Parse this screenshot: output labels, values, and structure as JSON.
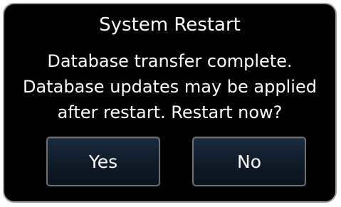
{
  "dialog": {
    "title": "System Restart",
    "message_lines": [
      "Database transfer complete.",
      "Database updates may be applied",
      "after restart. Restart now?"
    ],
    "buttons": {
      "yes_label": "Yes",
      "no_label": "No"
    }
  },
  "colors": {
    "background": "#000000",
    "border": "#9a9a9a",
    "button_fill": "#101b29",
    "text": "#ffffff"
  }
}
